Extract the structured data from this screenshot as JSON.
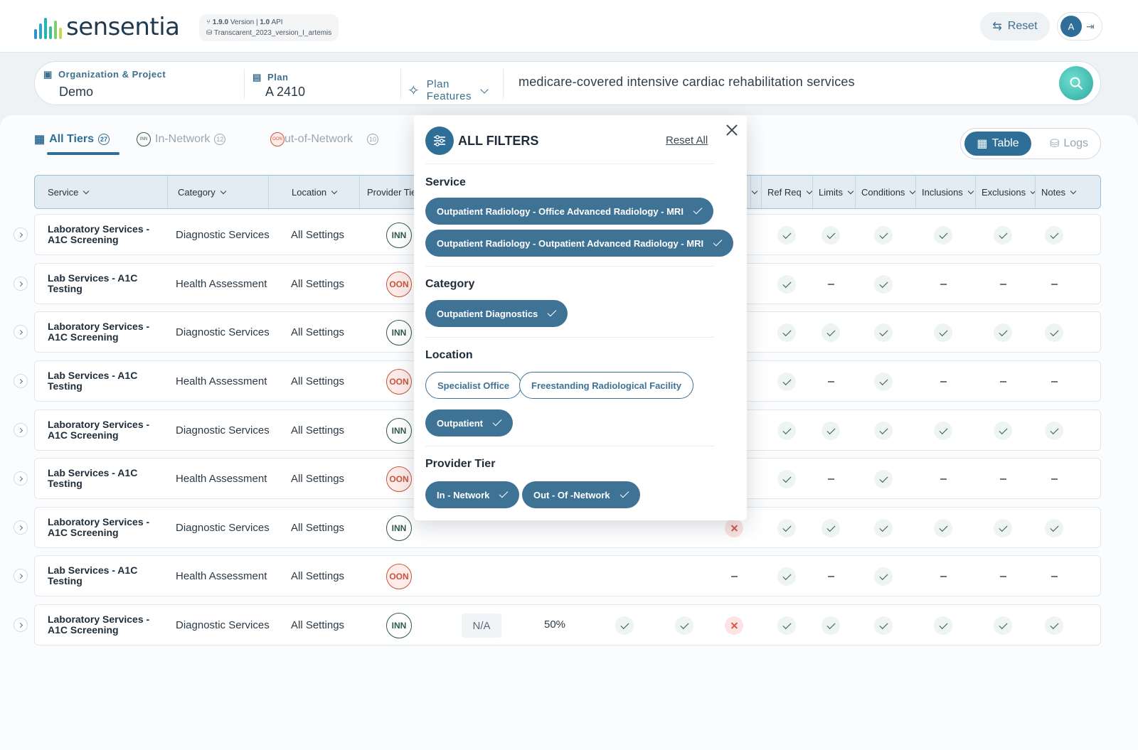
{
  "app": {
    "name": "sensentia",
    "version_num": "1.9.0",
    "version_word": "Version",
    "api_num": "1.0",
    "api_word": "API",
    "project_file": "Transcarent_2023_version_I_artemis",
    "reset_label": "Reset",
    "avatar_initial": "A"
  },
  "search": {
    "org_label": "Organization & Project",
    "org_value": "Demo",
    "plan_label": "Plan",
    "plan_value": "A 2410",
    "features_label_1": "Plan",
    "features_label_2": "Features",
    "query": "medicare-covered intensive cardiac rehabilitation services"
  },
  "tabs": [
    {
      "label": "All Tiers",
      "count": "27"
    },
    {
      "label": "In-Network",
      "count": "12"
    },
    {
      "label": "ut-of-Network",
      "count": "10"
    }
  ],
  "view": {
    "table_label": "Table",
    "logs_label": "Logs"
  },
  "columns": [
    "Service",
    "Category",
    "Location",
    "Provider Tie",
    "Ref Req",
    "Limits",
    "Conditions",
    "Inclusions",
    "Exclusions",
    "Notes"
  ],
  "rows": [
    {
      "service": "Laboratory Services - A1C Screening",
      "category": "Diagnostic Services",
      "location": "All Settings",
      "tier": "INN",
      "marks": [
        "check",
        "check",
        "check",
        "check",
        "check",
        "check"
      ]
    },
    {
      "service": "Lab Services - A1C Testing",
      "category": "Health Assessment",
      "location": "All Settings",
      "tier": "OON",
      "marks": [
        "check",
        "dash",
        "check",
        "dash",
        "dash",
        "dash"
      ]
    },
    {
      "service": "Laboratory Services - A1C Screening",
      "category": "Diagnostic Services",
      "location": "All Settings",
      "tier": "INN",
      "marks": [
        "check",
        "check",
        "check",
        "check",
        "check",
        "check"
      ]
    },
    {
      "service": "Lab Services - A1C Testing",
      "category": "Health Assessment",
      "location": "All Settings",
      "tier": "OON",
      "marks": [
        "check",
        "dash",
        "check",
        "dash",
        "dash",
        "dash"
      ]
    },
    {
      "service": "Laboratory Services - A1C Screening",
      "category": "Diagnostic Services",
      "location": "All Settings",
      "tier": "INN",
      "marks": [
        "check",
        "check",
        "check",
        "check",
        "check",
        "check"
      ]
    },
    {
      "service": "Lab Services - A1C Testing",
      "category": "Health Assessment",
      "location": "All Settings",
      "tier": "OON",
      "marks": [
        "check",
        "dash",
        "check",
        "dash",
        "dash",
        "dash"
      ]
    },
    {
      "service": "Laboratory Services - A1C Screening",
      "category": "Diagnostic Services",
      "location": "All Settings",
      "tier": "INN",
      "prior": "cross",
      "marks": [
        "check",
        "check",
        "check",
        "check",
        "check",
        "check"
      ]
    },
    {
      "service": "Lab Services - A1C Testing",
      "category": "Health Assessment",
      "location": "All Settings",
      "tier": "OON",
      "prior": "dash",
      "marks": [
        "check",
        "dash",
        "check",
        "dash",
        "dash",
        "dash"
      ]
    },
    {
      "service": "Laboratory Services - A1C Screening",
      "category": "Diagnostic Services",
      "location": "All Settings",
      "tier": "INN",
      "na": "N/A",
      "pct": "50%",
      "extra": [
        "check",
        "check"
      ],
      "prior": "cross",
      "marks": [
        "check",
        "check",
        "check",
        "check",
        "check",
        "check"
      ]
    }
  ],
  "filters": {
    "title": "ALL FILTERS",
    "reset_all": "Reset All",
    "service_head": "Service",
    "service": [
      "Outpatient Radiology - Office Advanced Radiology - MRI",
      "Outpatient Radiology - Outpatient Advanced Radiology - MRI"
    ],
    "category_head": "Category",
    "category": [
      "Outpatient Diagnostics"
    ],
    "location_head": "Location",
    "location": [
      "Specialist Office",
      "Freestanding Radiological Facility",
      "Outpatient"
    ],
    "tier_head": "Provider Tier",
    "tier": [
      "In - Network",
      "Out  - Of -Network"
    ]
  },
  "colors": {
    "primary": "#2f6e96",
    "inn": "#2f5a4a",
    "oon": "#c8553d"
  }
}
